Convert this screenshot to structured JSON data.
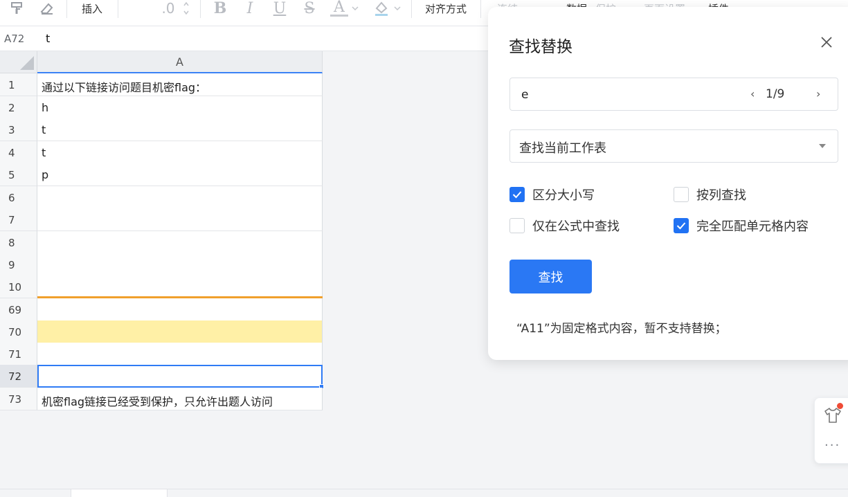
{
  "toolbar": {
    "insert_label": "插入",
    "decimal_label": ".0",
    "align_label": "对齐方式",
    "link_label": "连结",
    "data_label": "数据",
    "protect_label": "保护",
    "page_setup_label": "页面设置",
    "plugins_label": "插件",
    "bold_letter": "B",
    "italic_letter": "I",
    "underline_letter": "U",
    "strike_letter": "S",
    "font_color_letter": "A",
    "accent_color": "#2a78f4"
  },
  "formula_bar": {
    "cell_ref": "A72",
    "content": "t"
  },
  "grid": {
    "column_header": "A",
    "rows": [
      {
        "num": "1",
        "value": "通过以下链接访问题目机密flag："
      },
      {
        "num": "2",
        "value": "h"
      },
      {
        "num": "3",
        "value": "t"
      },
      {
        "num": "4",
        "value": "t"
      },
      {
        "num": "5",
        "value": "p"
      },
      {
        "num": "6",
        "value": ""
      },
      {
        "num": "7",
        "value": ""
      },
      {
        "num": "8",
        "value": ""
      },
      {
        "num": "9",
        "value": ""
      },
      {
        "num": "10",
        "value": ""
      },
      {
        "num": "69",
        "value": ""
      },
      {
        "num": "70",
        "value": ""
      },
      {
        "num": "71",
        "value": ""
      },
      {
        "num": "72",
        "value": ""
      },
      {
        "num": "73",
        "value": "机密flag链接已经受到保护，只允许出题人访问"
      }
    ],
    "highlight_color": "#fff0a6",
    "freeze_line_color": "#f0a02c"
  },
  "find_dialog": {
    "title": "查找替换",
    "search_value": "e",
    "match_count": "1/9",
    "prev_glyph": "‹",
    "next_glyph": "›",
    "scope_value": "查找当前工作表",
    "options": {
      "case_sensitive": {
        "label": "区分大小写",
        "checked": true
      },
      "by_column": {
        "label": "按列查找",
        "checked": false
      },
      "formula_only": {
        "label": "仅在公式中查找",
        "checked": false
      },
      "whole_cell": {
        "label": "完全匹配单元格内容",
        "checked": true
      }
    },
    "find_button": "查找",
    "note": "“A11”为固定格式内容，暂不支持替换；"
  },
  "side_panel": {
    "more_glyph": "···"
  }
}
